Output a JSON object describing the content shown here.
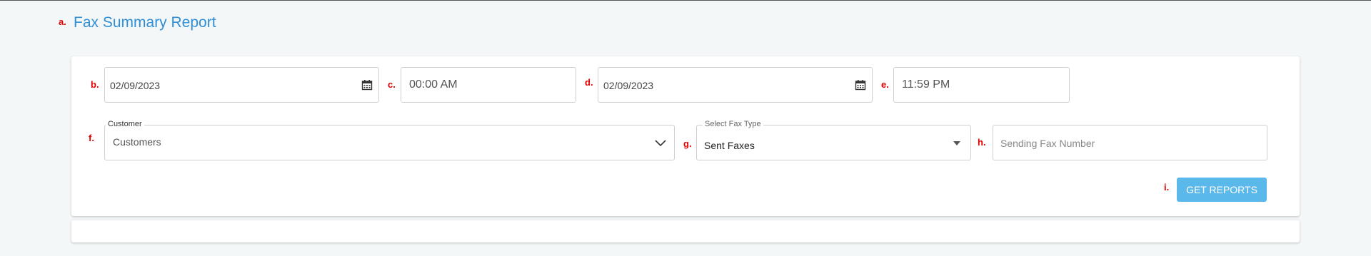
{
  "markers": {
    "a": "a.",
    "b": "b.",
    "c": "c.",
    "d": "d.",
    "e": "e.",
    "f": "f.",
    "g": "g.",
    "h": "h.",
    "i": "i."
  },
  "page": {
    "title": "Fax Summary Report"
  },
  "filters": {
    "start_date": "02/09/2023",
    "start_time": "00:00 AM",
    "end_date": "02/09/2023",
    "end_time": "11:59 PM",
    "customer_label": "Customer",
    "customer_value": "Customers",
    "fax_type_label": "Select Fax Type",
    "fax_type_value": "Sent Faxes",
    "sending_fax_placeholder": "Sending Fax Number"
  },
  "actions": {
    "get_reports": "GET REPORTS"
  },
  "colors": {
    "accent": "#2f8ed4",
    "button": "#5bb8ea",
    "marker": "#e00000"
  },
  "icons": [
    "calendar-icon",
    "chevron-down-icon",
    "caret-down-icon"
  ]
}
